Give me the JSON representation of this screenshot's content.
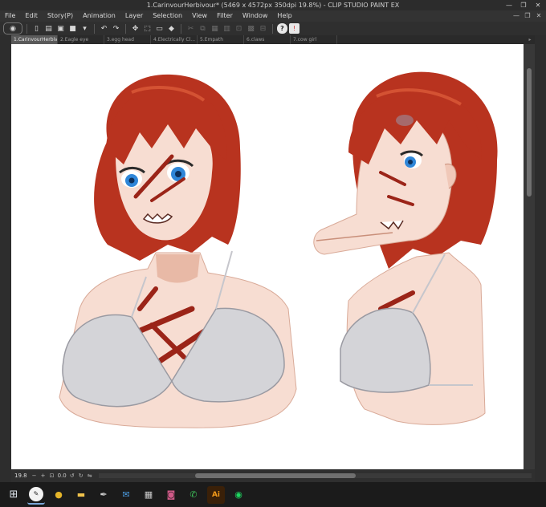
{
  "window": {
    "title": "1.CarinvourHerbivour* (5469 x 4572px 350dpi 19.8%) - CLIP STUDIO PAINT EX",
    "controls": {
      "minimize": "—",
      "maximize": "❐",
      "close": "✕"
    }
  },
  "menu": {
    "items": [
      "File",
      "Edit",
      "Story(P)",
      "Animation",
      "Layer",
      "Selection",
      "View",
      "Filter",
      "Window",
      "Help"
    ]
  },
  "toolbar": {
    "icons": [
      "eye-icon",
      "new-file-icon",
      "open-icon",
      "save-icon",
      "color-icon",
      "undo-icon",
      "redo-icon",
      "transform-icon",
      "selection-icon",
      "clear-icon",
      "fill-icon",
      "cut-icon",
      "copy-icon",
      "paste-icon",
      "layer-icon",
      "help-icon",
      "warning-icon"
    ]
  },
  "tabs": [
    {
      "label": "1.CarinvourHerbivour*",
      "active": true
    },
    {
      "label": "2.Eagle eye",
      "active": false
    },
    {
      "label": "3.egg head",
      "active": false
    },
    {
      "label": "4.Electrically Cl...",
      "active": false
    },
    {
      "label": "5.Empath",
      "active": false
    },
    {
      "label": "6.claws",
      "active": false
    },
    {
      "label": "7.cow girl",
      "active": false
    }
  ],
  "status": {
    "zoom": "19.8",
    "rotation": "0.0"
  },
  "taskbar": {
    "apps": [
      "windows-start-icon",
      "clip-studio-icon",
      "chrome-icon",
      "file-explorer-icon",
      "pen-tool-icon",
      "outlook-icon",
      "calculator-icon",
      "photos-icon",
      "whatsapp-icon",
      "illustrator-icon",
      "spotify-icon"
    ]
  },
  "colors": {
    "hair": "#b8331f",
    "hair_shadow": "#7e1e12",
    "skin": "#f7ddd2",
    "skin_shadow": "#e8b9a6",
    "bikini": "#d4d4d8",
    "eye": "#2f86d8",
    "scar": "#9b2418"
  }
}
